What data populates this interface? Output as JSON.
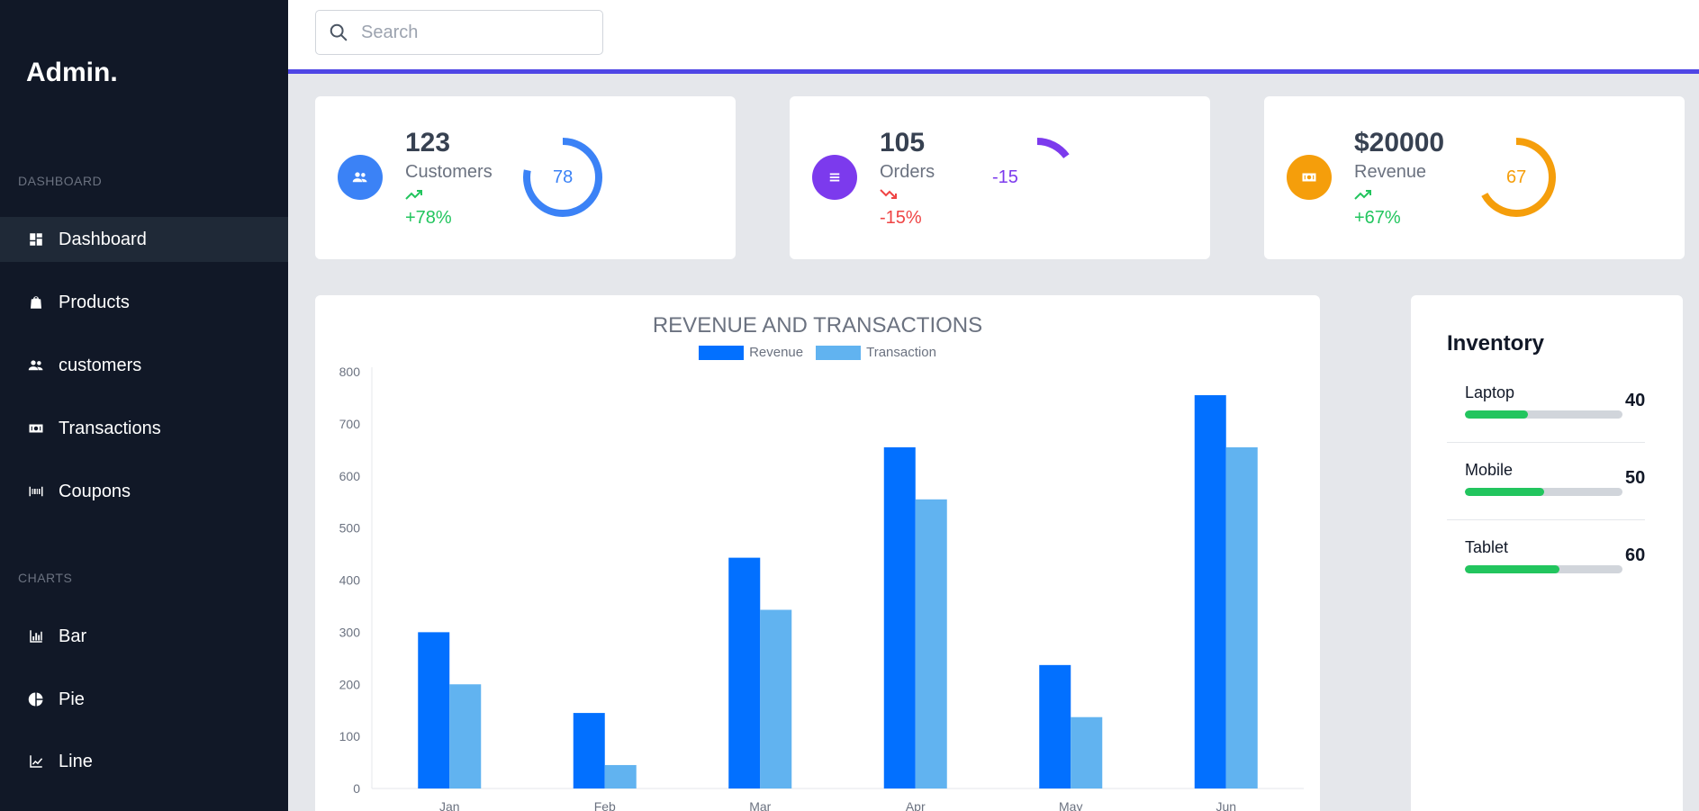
{
  "app": {
    "brand": "Admin."
  },
  "sidebar": {
    "sections": [
      {
        "label": "DASHBOARD"
      },
      {
        "label": "CHARTS"
      }
    ],
    "items": [
      {
        "label": "Dashboard",
        "icon": "dashboard-icon",
        "active": true
      },
      {
        "label": "Products",
        "icon": "shopping-bag-icon"
      },
      {
        "label": "customers",
        "icon": "people-icon"
      },
      {
        "label": "Transactions",
        "icon": "cash-icon"
      },
      {
        "label": "Coupons",
        "icon": "barcode-icon"
      },
      {
        "label": "Bar",
        "icon": "bar-chart-icon"
      },
      {
        "label": "Pie",
        "icon": "pie-chart-icon"
      },
      {
        "label": "Line",
        "icon": "line-chart-icon"
      }
    ]
  },
  "header": {
    "search_placeholder": "Search",
    "accent": "#4f46e5"
  },
  "stats": [
    {
      "value": "123",
      "label": "Customers",
      "pct": "+78%",
      "trend": "up",
      "gauge_value": "78",
      "gauge_fraction": 0.78,
      "color": "#3b82f6",
      "icon": "people-icon"
    },
    {
      "value": "105",
      "label": "Orders",
      "pct": "-15%",
      "trend": "down",
      "gauge_value": "-15",
      "gauge_fraction": 0.15,
      "color": "#7c3aed",
      "icon": "list-icon"
    },
    {
      "value": "$20000",
      "label": "Revenue",
      "pct": "+67%",
      "trend": "up",
      "gauge_value": "67",
      "gauge_fraction": 0.67,
      "color": "#f59e0b",
      "icon": "cash-icon"
    }
  ],
  "colors": {
    "positive": "#22c55e",
    "negative": "#ef4444",
    "revenue": "#0270ff",
    "transaction": "#61b3f0"
  },
  "chart_data": {
    "type": "bar",
    "title": "REVENUE AND TRANSACTIONS",
    "categories": [
      "Jan",
      "Feb",
      "Mar",
      "Apr",
      "May",
      "Jun"
    ],
    "series": [
      {
        "name": "Revenue",
        "values": [
          300,
          145,
          443,
          655,
          237,
          755
        ]
      },
      {
        "name": "Transaction",
        "values": [
          200,
          45,
          343,
          555,
          137,
          655
        ]
      }
    ],
    "ylim": [
      0,
      800
    ],
    "yticks": [
      "0",
      "100",
      "200",
      "300",
      "400",
      "500",
      "600",
      "700",
      "800"
    ],
    "legend_position": "top-center",
    "grid": false
  },
  "inventory": {
    "title": "Inventory",
    "items": [
      {
        "name": "Laptop",
        "count": "40",
        "fraction": 0.4
      },
      {
        "name": "Mobile",
        "count": "50",
        "fraction": 0.5
      },
      {
        "name": "Tablet",
        "count": "60",
        "fraction": 0.6
      }
    ]
  }
}
